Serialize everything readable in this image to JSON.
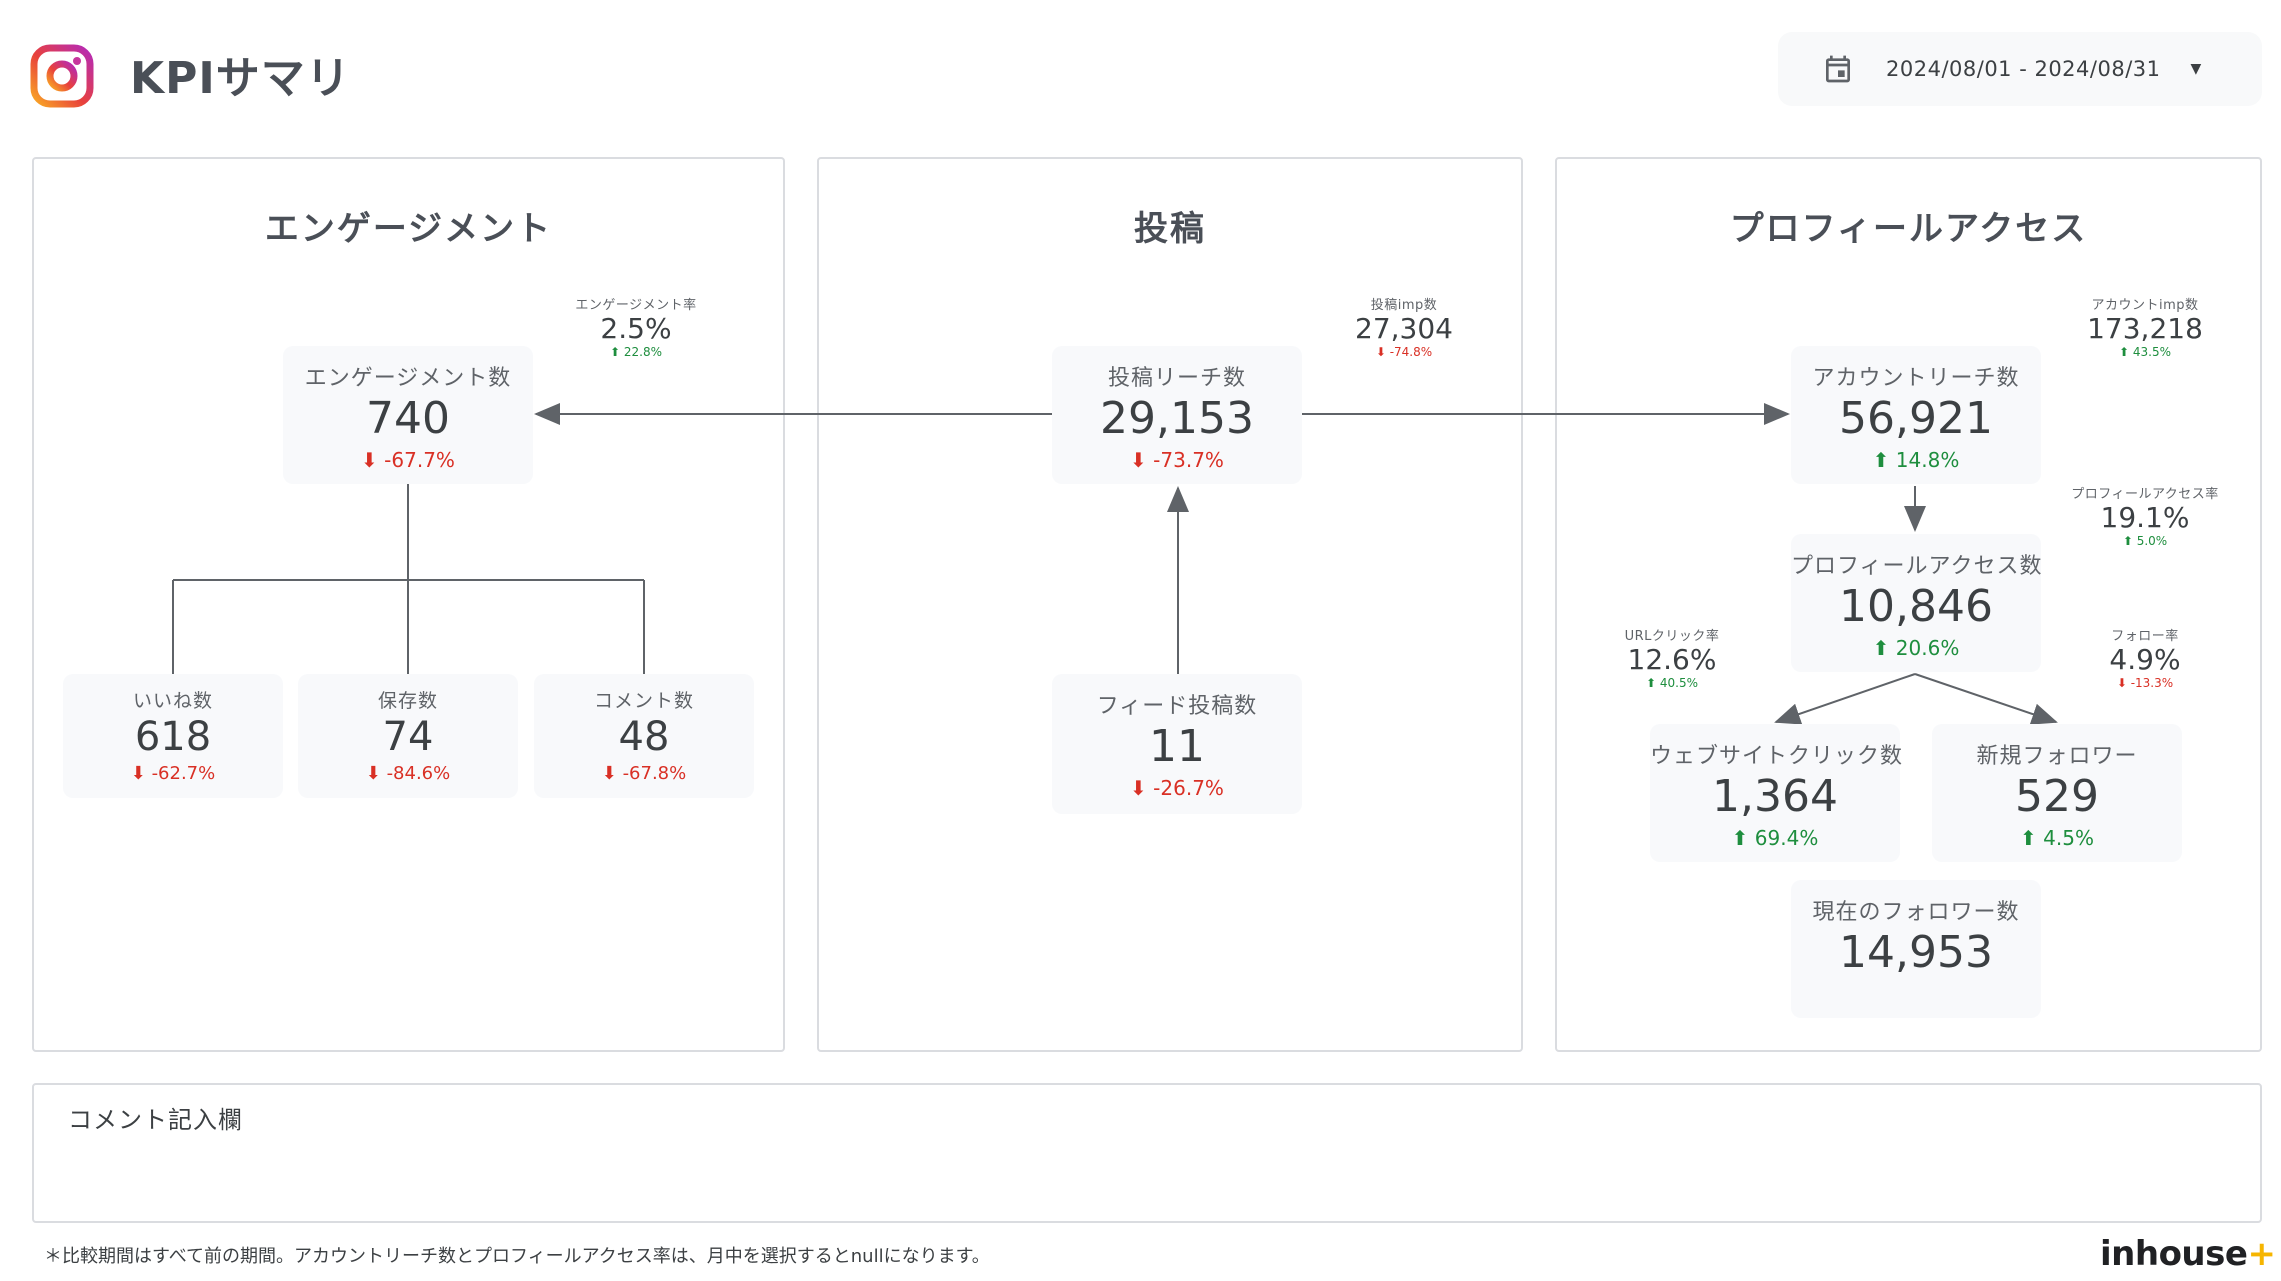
{
  "header": {
    "title": "KPIサマリ",
    "date_range": "2024/08/01 - 2024/08/31"
  },
  "engagement": {
    "title": "エンゲージメント",
    "rate": {
      "label": "エンゲージメント率",
      "value": "2.5%",
      "change": "22.8%"
    },
    "total": {
      "label": "エンゲージメント数",
      "value": "740",
      "change": "-67.7%"
    },
    "likes": {
      "label": "いいね数",
      "value": "618",
      "change": "-62.7%"
    },
    "saves": {
      "label": "保存数",
      "value": "74",
      "change": "-84.6%"
    },
    "comments": {
      "label": "コメント数",
      "value": "48",
      "change": "-67.8%"
    }
  },
  "posts": {
    "title": "投稿",
    "imp": {
      "label": "投稿imp数",
      "value": "27,304",
      "change": "-74.8%"
    },
    "reach": {
      "label": "投稿リーチ数",
      "value": "29,153",
      "change": "-73.7%"
    },
    "feed": {
      "label": "フィード投稿数",
      "value": "11",
      "change": "-26.7%"
    }
  },
  "profile": {
    "title": "プロフィールアクセス",
    "account_imp": {
      "label": "アカウントimp数",
      "value": "173,218",
      "change": "43.5%"
    },
    "account_reach": {
      "label": "アカウントリーチ数",
      "value": "56,921",
      "change": "14.8%"
    },
    "access_rate": {
      "label": "プロフィールアクセス率",
      "value": "19.1%",
      "change": "5.0%"
    },
    "access_count": {
      "label": "プロフィールアクセス数",
      "value": "10,846",
      "change": "20.6%"
    },
    "url_rate": {
      "label": "URLクリック率",
      "value": "12.6%",
      "change": "40.5%"
    },
    "follow_rate": {
      "label": "フォロー率",
      "value": "4.9%",
      "change": "-13.3%"
    },
    "web_clicks": {
      "label": "ウェブサイトクリック数",
      "value": "1,364",
      "change": "69.4%"
    },
    "new_followers": {
      "label": "新規フォロワー",
      "value": "529",
      "change": "4.5%"
    },
    "followers": {
      "label": "現在のフォロワー数",
      "value": "14,953"
    }
  },
  "comment_section": {
    "label": "コメント記入欄"
  },
  "footnote": "＊比較期間はすべて前の期間。アカウントリーチ数とプロフィールアクセス率は、月中を選択するとnullになります。",
  "brand": {
    "name": "inhouse",
    "plus": "+"
  },
  "colors": {
    "down": "#d93025",
    "up": "#1e8e3e",
    "card_bg": "#f8f9fb",
    "border": "#dadce0"
  }
}
